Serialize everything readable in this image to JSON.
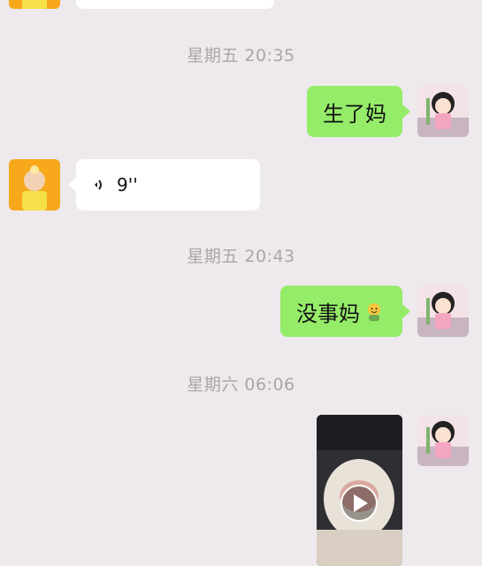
{
  "messages": {
    "timestamp_1": "星期五 20:35",
    "msg_1": "生了妈",
    "voice_duration": "9''",
    "timestamp_2": "星期五 20:43",
    "msg_2": "没事妈",
    "timestamp_3": "星期六 06:06"
  },
  "colors": {
    "background": "#ede9ed",
    "sent_bubble": "#95ec69",
    "received_bubble": "#ffffff",
    "timestamp_text": "#a9a5a9"
  },
  "icons": [
    "voice-wave-icon",
    "smile-emoji-icon",
    "play-icon"
  ]
}
